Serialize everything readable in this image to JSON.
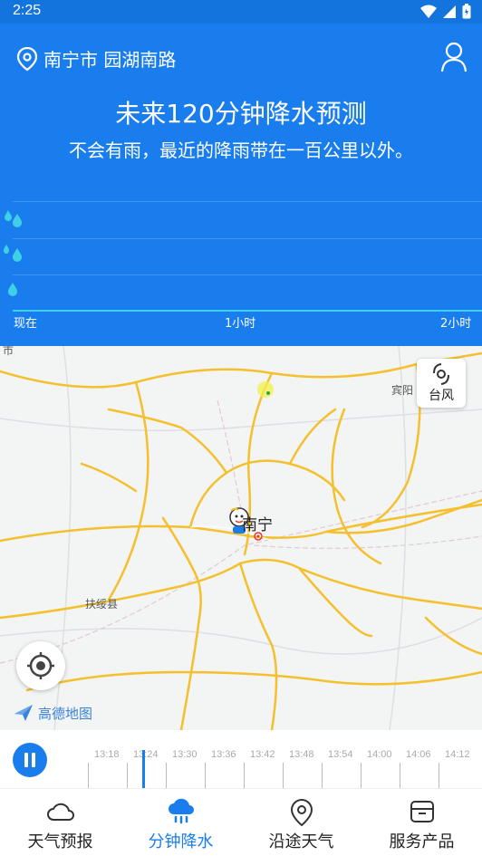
{
  "status_bar": {
    "time": "2:25"
  },
  "header": {
    "location": "南宁市 园湖南路",
    "title": "未来120分钟降水预测",
    "subtitle": "不会有雨，最近的降雨带在一百公里以外。"
  },
  "chart_axis": [
    "现在",
    "1小时",
    "2小时"
  ],
  "map": {
    "labels": {
      "city_main": "南宁",
      "city_fusui": "扶绥县",
      "city_binyang": "宾阳",
      "city_edge": "市"
    },
    "typhoon_label": "台风",
    "provider_logo": "高德地图"
  },
  "timeline": {
    "ticks": [
      "13:18",
      "13:24",
      "13:30",
      "13:36",
      "13:42",
      "13:48",
      "13:54",
      "14:00",
      "14:06",
      "14:12"
    ],
    "current": "13:24"
  },
  "tabs": [
    {
      "label": "天气预报",
      "icon": "cloud-icon",
      "active": false
    },
    {
      "label": "分钟降水",
      "icon": "rain-cloud-icon",
      "active": true
    },
    {
      "label": "沿途天气",
      "icon": "route-pin-icon",
      "active": false
    },
    {
      "label": "服务产品",
      "icon": "box-icon",
      "active": false
    }
  ],
  "colors": {
    "header_blue": "#1a7ded",
    "accent_cyan": "#3fd0e8",
    "road_yellow": "#f4c02e"
  }
}
